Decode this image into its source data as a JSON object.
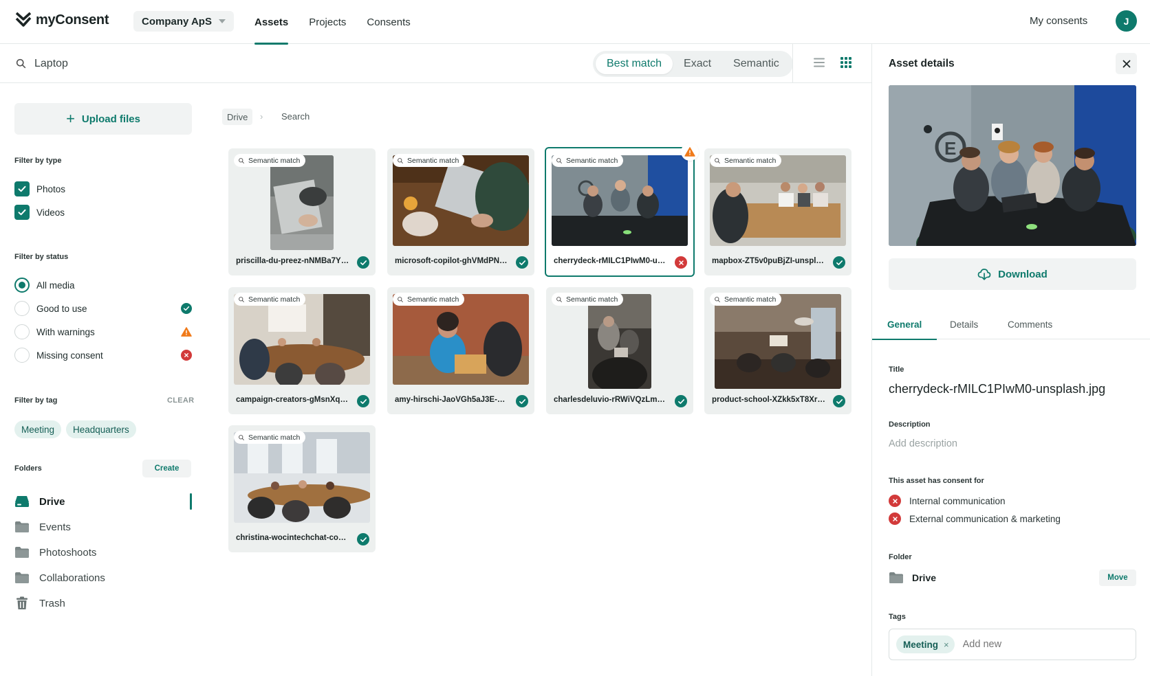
{
  "app": {
    "name": "myConsent",
    "company": "Company ApS",
    "user_initial": "J"
  },
  "nav": {
    "tabs": [
      "Assets",
      "Projects",
      "Consents"
    ],
    "active": "Assets",
    "my_consents": "My consents"
  },
  "search": {
    "value": "Laptop",
    "modes": [
      "Best match",
      "Exact",
      "Semantic"
    ],
    "active_mode": "Best match"
  },
  "sidebar": {
    "upload_label": "Upload files",
    "filter_type_heading": "Filter by type",
    "types": [
      {
        "label": "Photos",
        "checked": true
      },
      {
        "label": "Videos",
        "checked": true
      }
    ],
    "filter_status_heading": "Filter by status",
    "statuses": [
      {
        "label": "All media",
        "selected": true,
        "icon": "none"
      },
      {
        "label": "Good to use",
        "selected": false,
        "icon": "check-icon"
      },
      {
        "label": "With warnings",
        "selected": false,
        "icon": "warning-icon"
      },
      {
        "label": "Missing consent",
        "selected": false,
        "icon": "error-icon"
      }
    ],
    "filter_tag_heading": "Filter by tag",
    "clear_label": "CLEAR",
    "tags": [
      "Meeting",
      "Headquarters"
    ],
    "folders_heading": "Folders",
    "create_label": "Create",
    "folders": [
      {
        "label": "Drive",
        "icon": "drive-icon",
        "active": true
      },
      {
        "label": "Events",
        "icon": "folder-icon",
        "active": false
      },
      {
        "label": "Photoshoots",
        "icon": "folder-icon",
        "active": false
      },
      {
        "label": "Collaborations",
        "icon": "folder-icon",
        "active": false
      },
      {
        "label": "Trash",
        "icon": "trash-icon",
        "active": false
      }
    ]
  },
  "breadcrumb": [
    "Drive",
    "Search"
  ],
  "assets": [
    {
      "name": "priscilla-du-preez-nNMBa7Y1Y...",
      "badge": "Semantic match",
      "status": "good"
    },
    {
      "name": "microsoft-copilot-ghVMdPN33v...",
      "badge": "Semantic match",
      "status": "good"
    },
    {
      "name": "cherrydeck-rMILC1PIwM0-unspl...",
      "badge": "Semantic match",
      "status": "missing",
      "warning": true,
      "selected": true
    },
    {
      "name": "mapbox-ZT5v0puBjZI-unsplash....",
      "badge": "Semantic match",
      "status": "good"
    },
    {
      "name": "campaign-creators-gMsnXqILjp...",
      "badge": "Semantic match",
      "status": "good"
    },
    {
      "name": "amy-hirschi-JaoVGh5aJ3E-unsp...",
      "badge": "Semantic match",
      "status": "good"
    },
    {
      "name": "charlesdeluvio-rRWiVQzLm7k-u...",
      "badge": "Semantic match",
      "status": "good"
    },
    {
      "name": "product-school-XZkk5xT8Xrk-u...",
      "badge": "Semantic match",
      "status": "good"
    },
    {
      "name": "christina-wocintechchat-com-m...",
      "badge": "Semantic match",
      "status": "good"
    }
  ],
  "details": {
    "heading": "Asset details",
    "download_label": "Download",
    "tabs": [
      "General",
      "Details",
      "Comments"
    ],
    "active_tab": "General",
    "title_label": "Title",
    "title_value": "cherrydeck-rMILC1PIwM0-unsplash.jpg",
    "description_label": "Description",
    "description_placeholder": "Add description",
    "consent_heading": "This asset has consent for",
    "consents": [
      {
        "label": "Internal communication",
        "status": "missing"
      },
      {
        "label": "External communication & marketing",
        "status": "missing"
      }
    ],
    "folder_label": "Folder",
    "folder_value": "Drive",
    "move_label": "Move",
    "tags_label": "Tags",
    "tags": [
      "Meeting"
    ],
    "tag_placeholder": "Add new"
  },
  "colors": {
    "accent": "#0e7a6c",
    "error": "#d23a3a",
    "warning": "#f07a1a"
  }
}
